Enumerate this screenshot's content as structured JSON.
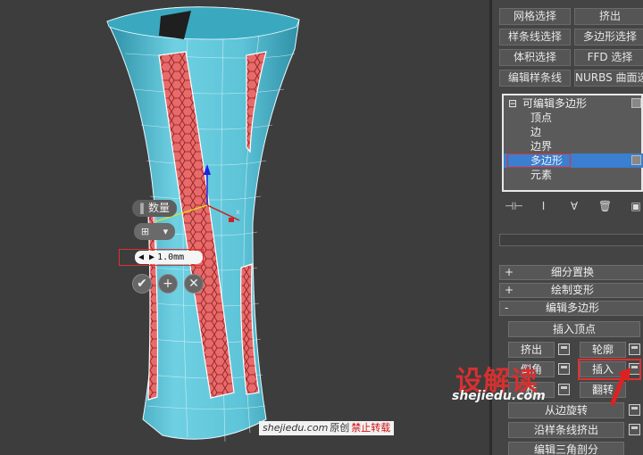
{
  "viewport": {
    "caddy": {
      "title": "数量",
      "value": "1.0mm",
      "ok_glyph": "✔",
      "apply_glyph": "+",
      "cancel_glyph": "✕"
    },
    "watermark": {
      "site": "shejiedu.com",
      "original": "原创",
      "warning": "禁止转载"
    },
    "gizmo_label": "x"
  },
  "panel": {
    "modifier_buttons": [
      [
        "网格选择",
        "挤出"
      ],
      [
        "样条线选择",
        "多边形选择"
      ],
      [
        "体积选择",
        "FFD 选择"
      ],
      [
        "编辑样条线",
        "NURBS 曲面选择"
      ]
    ],
    "stack": {
      "root": "可编辑多边形",
      "items": [
        "顶点",
        "边",
        "边界",
        "多边形",
        "元素"
      ],
      "selected_index": 3
    },
    "rollouts": [
      {
        "sign": "+",
        "label": "细分置换"
      },
      {
        "sign": "+",
        "label": "绘制变形"
      },
      {
        "sign": "-",
        "label": "编辑多边形"
      }
    ],
    "ops": {
      "insert_vertex": "插入顶点",
      "extrude": "挤出",
      "outline": "轮廓",
      "bevel": "倒角",
      "inset": "插入",
      "bridge": "桥",
      "flip": "翻转",
      "hinge": "从边旋转",
      "extrude_spline": "沿样条线挤出",
      "edit_tri": "编辑三角剖分"
    },
    "brand": {
      "logo": "设解读",
      "url": "shejiedu.com"
    }
  }
}
